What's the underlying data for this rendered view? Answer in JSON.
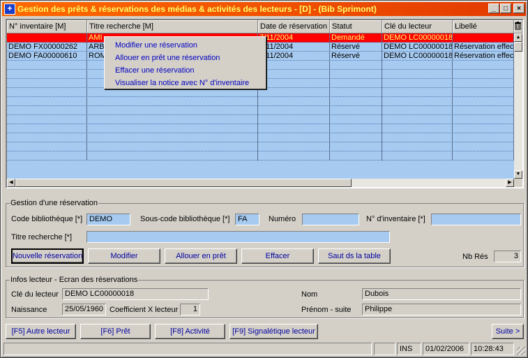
{
  "window": {
    "title": "Gestion des prêts & réservations des médias & activités des lecteurs - [D] - (Bib Sprimont)",
    "app_icon_glyph": "+",
    "minimize_glyph": "_",
    "maximize_glyph": "□",
    "close_glyph": "×"
  },
  "grid": {
    "columns": [
      "N° inventaire [M]",
      "Titre recherche [M]",
      "Date de réservation",
      "Statut",
      "Clé du lecteur",
      "Libellé"
    ],
    "rows": [
      {
        "inventaire": "",
        "titre": "AMI",
        "date": "7/11/2004",
        "statut": "Demandé",
        "cle": "DEMO LC00000018",
        "libelle": ""
      },
      {
        "inventaire": "DEMO FX00000262",
        "titre": "ARBI",
        "date": "7/11/2004",
        "statut": "Réservé",
        "cle": "DEMO LC00000018",
        "libelle": "Réservation effect"
      },
      {
        "inventaire": "DEMO FA00000610",
        "titre": "ROM",
        "date": "7/11/2004",
        "statut": "Réservé",
        "cle": "DEMO LC00000018",
        "libelle": "Réservation effect"
      }
    ],
    "selected_row": 0,
    "empty_row_count": 11,
    "corner_icon": "trash-icon"
  },
  "context_menu": {
    "items": [
      "Modifier une réservation",
      "Allouer en prêt une réservation",
      "Effacer une réservation",
      "Visualiser la notice avec N° d'inventaire"
    ]
  },
  "reservation": {
    "group_title": "Gestion d'une réservation",
    "code_label": "Code bibliothèque [*]",
    "code_value": "DEMO",
    "souscode_label": "Sous-code bibliothèque [*]",
    "souscode_value": "FA",
    "numero_label": "Numéro",
    "numero_value": "",
    "inventaire_label": "N° d'inventaire [*]",
    "inventaire_value": "",
    "titre_label": "Titre recherche [*]",
    "titre_value": "",
    "buttons": {
      "nouvelle": "Nouvelle réservation",
      "modifier": "Modifier",
      "allouer": "Allouer en prêt",
      "effacer": "Effacer",
      "saut": "Saut ds la table"
    },
    "nb_res_label": "Nb Rés",
    "nb_res_value": "3"
  },
  "lecteur": {
    "group_title": "Infos lecteur - Ecran des réservations",
    "cle_label": "Clé du lecteur",
    "cle_value": "DEMO LC00000018",
    "naissance_label": "Naissance",
    "naissance_value": "25/05/1960",
    "coef_label": "Coefficient X lecteur",
    "coef_value": "1",
    "nom_label": "Nom",
    "nom_value": "Dubois",
    "prenom_label": "Prénom - suite",
    "prenom_value": "Philippe"
  },
  "footer_buttons": {
    "autre_lecteur": "[F5] Autre lecteur",
    "pret": "[F6] Prêt",
    "activite": "[F8] Activité",
    "signaletique": "[F9] Signalétique lecteur",
    "suite": "Suite >"
  },
  "statusbar": {
    "message": "",
    "ins": "INS",
    "date": "01/02/2006",
    "time": "10:28:43"
  },
  "colors": {
    "titlebar": "#ff6a00",
    "title_text": "#ffff66",
    "grid_bg": "#a6caf0",
    "selected_row": "#ff0000",
    "button_text": "#0000a0"
  }
}
